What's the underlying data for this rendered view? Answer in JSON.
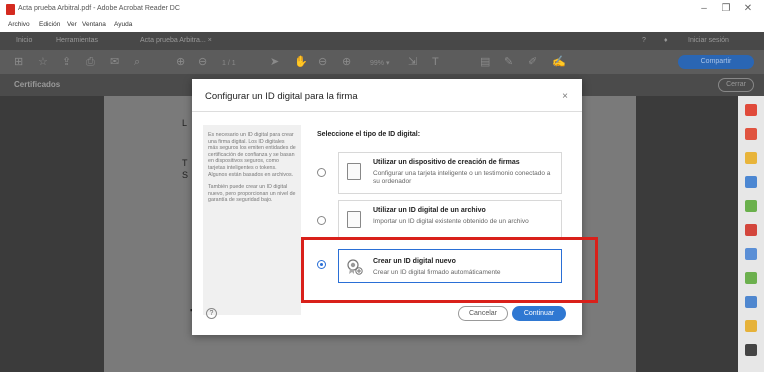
{
  "window": {
    "title": "Acta prueba Arbitral.pdf - Adobe Acrobat Reader DC",
    "controls": [
      "–",
      "❐",
      "✕"
    ]
  },
  "menu": [
    "Archivo",
    "Edición",
    "Ver",
    "Ventana",
    "Ayuda"
  ],
  "tabs": {
    "home": "Inicio",
    "tools": "Herramientas",
    "document": "Acta prueba Arbitra... ×",
    "signin": "Iniciar sesión"
  },
  "toolbar": {
    "page_count": "1 / 1",
    "zoom": "99% ▾",
    "share": "Compartir"
  },
  "certificates_bar": {
    "title": "Certificados",
    "close": "Cerrar"
  },
  "dialog": {
    "title": "Configurar un ID digital para la firma",
    "close": "×",
    "info": [
      "Es necesario un ID digital para crear una firma digital. Los ID digitales más seguros los emiten entidades de certificación de confianza y se basan en dispositivos seguros, como tarjetas inteligentes o tokens. Algunos están basados en archivos.",
      "También puede crear un ID digital nuevo, pero proporcionan un nivel de garantía de seguridad bajo."
    ],
    "select_heading": "Seleccione el tipo de ID digital:",
    "options": [
      {
        "title": "Utilizar un dispositivo de creación de firmas",
        "description": "Configurar una tarjeta inteligente o un testimonio conectado a su ordenador",
        "selected": false
      },
      {
        "title": "Utilizar un ID digital de un archivo",
        "description": "Importar un ID digital existente obtenido de un archivo",
        "selected": false
      },
      {
        "title": "Crear un ID digital nuevo",
        "description": "Crear un ID digital firmado automáticamente",
        "selected": true
      }
    ],
    "help": "?",
    "cancel": "Cancelar",
    "continue": "Continuar"
  },
  "colors": {
    "accent": "#2f78d2",
    "highlight": "#d9201a",
    "dark_chrome": "#484848"
  }
}
